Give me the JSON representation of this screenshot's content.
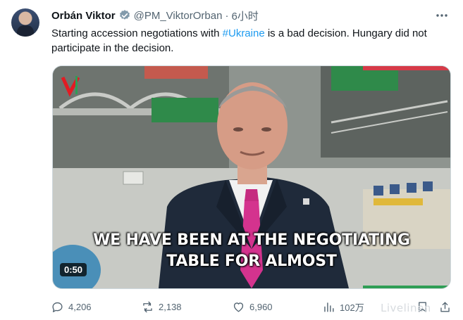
{
  "tweet": {
    "author_name": "Orbán Viktor",
    "handle": "@PM_ViktorOrban",
    "separator": "·",
    "time": "6小时",
    "text_before": "Starting accession negotiations with ",
    "hashtag": "#Ukraine",
    "text_after": " is a bad decision. Hungary did not participate in the decision."
  },
  "video": {
    "caption_line1": "WE HAVE BEEN AT THE NEGOTIATING",
    "caption_line2": "TABLE FOR ALMOST",
    "duration": "0:50"
  },
  "actions": {
    "replies": "4,206",
    "reposts": "2,138",
    "likes": "6,960",
    "views": "102万"
  },
  "watermark": "Livelinen",
  "colors": {
    "accent": "#1d9bf0",
    "muted": "#536471",
    "logo_red": "#e31b23",
    "tie": "#d4338e"
  },
  "icons": [
    "verified-badge-icon",
    "more-icon",
    "reply-icon",
    "repost-icon",
    "like-icon",
    "views-icon",
    "share-icon"
  ]
}
